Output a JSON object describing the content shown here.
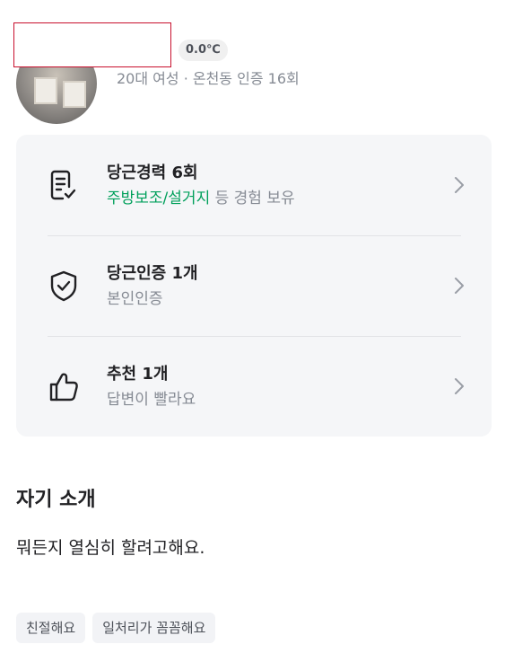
{
  "profile": {
    "temperature": "0.0℃",
    "meta": "20대 여성 · 온천동 인증 16회"
  },
  "cards": [
    {
      "icon": "checklist-icon",
      "title": "당근경력 6회",
      "sub_highlight": "주방보조/설거지",
      "sub_rest": " 등 경험 보유"
    },
    {
      "icon": "shield-check-icon",
      "title": "당근인증 1개",
      "sub": "본인인증"
    },
    {
      "icon": "thumbs-up-icon",
      "title": "추천 1개",
      "sub": "답변이 빨라요"
    }
  ],
  "intro": {
    "title": "자기 소개",
    "text": "뭐든지 열심히 할려고해요."
  },
  "tags": [
    "친절해요",
    "일처리가 꼼꼼해요"
  ],
  "colors": {
    "accent_green": "#00a05b",
    "card_bg": "#f5f6f8",
    "muted_text": "#868b94",
    "redaction_border": "#c8102e"
  }
}
